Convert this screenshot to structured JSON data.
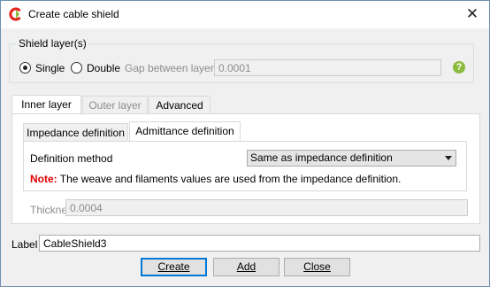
{
  "window": {
    "title": "Create cable shield",
    "close_glyph": "✕"
  },
  "shield_layers": {
    "legend": "Shield layer(s)",
    "single_label": "Single",
    "single_checked": true,
    "double_label": "Double",
    "gap_label": "Gap between layers",
    "gap_value": "0.0001",
    "help_glyph": "?"
  },
  "tabs": [
    {
      "label": "Inner layer",
      "active": true
    },
    {
      "label": "Outer layer",
      "active": false
    },
    {
      "label": "Advanced",
      "active": false
    }
  ],
  "subtabs": [
    {
      "label": "Impedance definition",
      "active": false
    },
    {
      "label": "Admittance definition",
      "active": true
    }
  ],
  "definition": {
    "method_label": "Definition method",
    "method_value": "Same as impedance definition",
    "note_prefix": "Note:",
    "note_text": " The weave and filaments values are used from the impedance definition."
  },
  "thickness": {
    "label": "Thickness",
    "value": "0.0004"
  },
  "label_field": {
    "label": "Label",
    "value": "CableShield3"
  },
  "buttons": {
    "create": "Create",
    "add": "Add",
    "close": "Close"
  },
  "colors": {
    "accent": "#0078d7",
    "note": "#e00000",
    "help": "#8cbb3c",
    "icon_red": "#e2231a"
  }
}
